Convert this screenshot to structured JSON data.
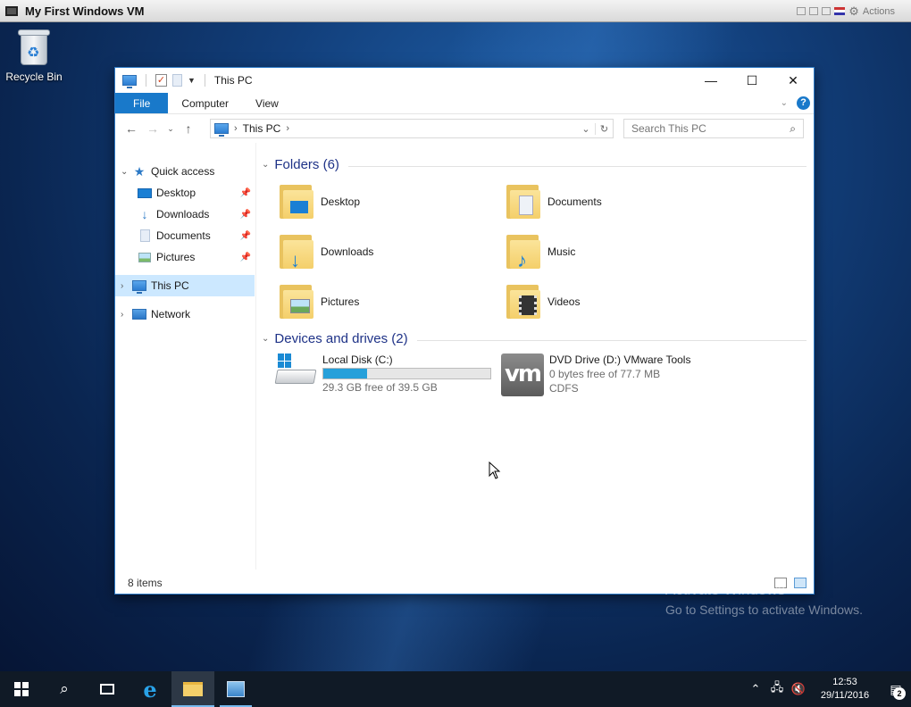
{
  "vm_window": {
    "title": "My First Windows VM",
    "actions_label": "Actions"
  },
  "desktop": {
    "recycle_bin_label": "Recycle Bin",
    "watermark_line1": "Activate Windows",
    "watermark_line2": "Go to Settings to activate Windows."
  },
  "explorer": {
    "title": "This PC",
    "ribbon_tabs": [
      "File",
      "Computer",
      "View"
    ],
    "address": {
      "crumb": "This PC"
    },
    "search": {
      "placeholder": "Search This PC"
    },
    "nav_pane": {
      "quick_access": "Quick access",
      "items": [
        {
          "label": "Desktop",
          "icon": "desktop-icon",
          "pinned": true
        },
        {
          "label": "Downloads",
          "icon": "downloads-icon",
          "pinned": true
        },
        {
          "label": "Documents",
          "icon": "documents-icon",
          "pinned": true
        },
        {
          "label": "Pictures",
          "icon": "pictures-icon",
          "pinned": true
        }
      ],
      "this_pc": "This PC",
      "network": "Network"
    },
    "folders_group": "Folders (6)",
    "folders": [
      {
        "name": "Desktop",
        "icon": "folder-desktop-icon"
      },
      {
        "name": "Documents",
        "icon": "folder-documents-icon"
      },
      {
        "name": "Downloads",
        "icon": "folder-downloads-icon"
      },
      {
        "name": "Music",
        "icon": "folder-music-icon"
      },
      {
        "name": "Pictures",
        "icon": "folder-pictures-icon"
      },
      {
        "name": "Videos",
        "icon": "folder-videos-icon"
      }
    ],
    "devices_group": "Devices and drives (2)",
    "drives": [
      {
        "name": "Local Disk (C:)",
        "free_text": "29.3 GB free of 39.5 GB",
        "used_fraction": 0.26,
        "icon": "hard-drive-icon"
      },
      {
        "name": "DVD Drive (D:) VMware Tools",
        "free_text": "0 bytes free of 77.7 MB",
        "fs": "CDFS",
        "icon": "vmware-icon",
        "icon_text": "vm"
      }
    ],
    "status": "8 items"
  },
  "taskbar": {
    "time": "12:53",
    "date": "29/11/2016",
    "notification_count": "2"
  },
  "colors": {
    "accent": "#1979ca",
    "selection": "#cce8ff",
    "group_header": "#1e3287",
    "drive_bar": "#26a0da"
  }
}
